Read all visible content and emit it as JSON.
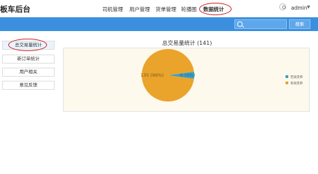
{
  "app": {
    "title": "板车后台"
  },
  "nav": {
    "items": [
      {
        "label": "司机管理",
        "active": false
      },
      {
        "label": "用户管理",
        "active": false
      },
      {
        "label": "货单管理",
        "active": false
      },
      {
        "label": "轮播图",
        "active": false
      },
      {
        "label": "数据统计",
        "active": true
      }
    ]
  },
  "user": {
    "name": "admin",
    "icon": "user-icon"
  },
  "search": {
    "placeholder": "",
    "button_label": "搜索",
    "icon": "search-icon"
  },
  "sidebar": {
    "items": [
      {
        "label": "总交易量统计",
        "active": true
      },
      {
        "label": "新订单统计",
        "active": false
      },
      {
        "label": "用户相关",
        "active": false
      },
      {
        "label": "意见反馈",
        "active": false
      }
    ]
  },
  "chart_data": {
    "type": "pie",
    "title": "总交易量统计 (141)",
    "categories": [
      "无效货单",
      "有效货单"
    ],
    "values": [
      6,
      135
    ],
    "labels": [
      "6 (4%)",
      "135 (96%)"
    ],
    "colors": [
      "#3aa0c4",
      "#eaa32b"
    ],
    "legend": "right"
  },
  "colors": {
    "accent": "#3c8fde",
    "highlight_ring": "#d01f1f"
  }
}
